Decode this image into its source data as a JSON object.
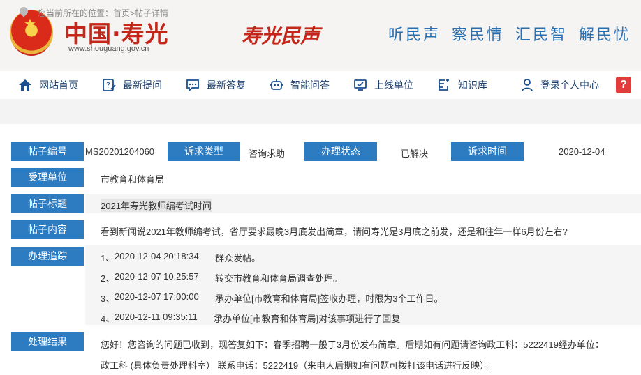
{
  "header": {
    "site_name": "中国·寿光",
    "site_url": "www.shouguang.gov.cn",
    "column_name": "寿光民声",
    "slogan": "听民声 察民情 汇民智 解民忧"
  },
  "nav": {
    "items": [
      {
        "label": "网站首页",
        "icon": "home-icon"
      },
      {
        "label": "最新提问",
        "icon": "question-edit-icon"
      },
      {
        "label": "最新答复",
        "icon": "chat-icon"
      },
      {
        "label": "智能问答",
        "icon": "robot-icon"
      },
      {
        "label": "上线单位",
        "icon": "monitor-icon"
      },
      {
        "label": "知识库",
        "icon": "book-edit-icon"
      },
      {
        "label": "登录个人中心",
        "icon": "user-icon"
      }
    ],
    "help_glyph": "?"
  },
  "breadcrumb": {
    "text": "您当前所在的位置：首页>帖子详情"
  },
  "detail": {
    "labels": {
      "post_no": "帖子编号",
      "request_type": "诉求类型",
      "status": "办理状态",
      "request_time": "诉求时间",
      "unit": "受理单位",
      "title": "帖子标题",
      "content": "帖子内容",
      "tracking": "办理追踪",
      "result": "处理结果"
    },
    "post_no": "MS20201204060",
    "request_type": "咨询求助",
    "status": "已解决",
    "request_time": "2020-12-04",
    "unit": "市教育和体育局",
    "title": "2021年寿光教师编考试时间",
    "content": "看到新闻说2021年教师编考试，省厅要求最晚3月底发出简章，请问寿光是3月底之前发，还是和往年一样6月份左右?",
    "tracking": [
      {
        "no": "1、",
        "time": "2020-12-04 20:18:34",
        "text": "群众发帖。"
      },
      {
        "no": "2、",
        "time": "2020-12-07 10:25:57",
        "text": "转交市教育和体育局调查处理。"
      },
      {
        "no": "3、",
        "time": "2020-12-07 17:00:00",
        "text": "承办单位[市教育和体育局]签收办理，时限为3个工作日。"
      },
      {
        "no": "4、",
        "time": "2020-12-11 09:35:11",
        "text": "承办单位[市教育和体育局]对该事项进行了回复"
      }
    ],
    "result_line1": "您好！您咨询的问题已收到，现答复如下：春季招聘一般于3月份发布简章。后期如有问题请咨询政工科：5222419经办单位：",
    "result_line2": "政工科 (具体负责处理科室）  联系电话：5222419（来电人后期如有问题可拨打该电话进行反映）。"
  }
}
